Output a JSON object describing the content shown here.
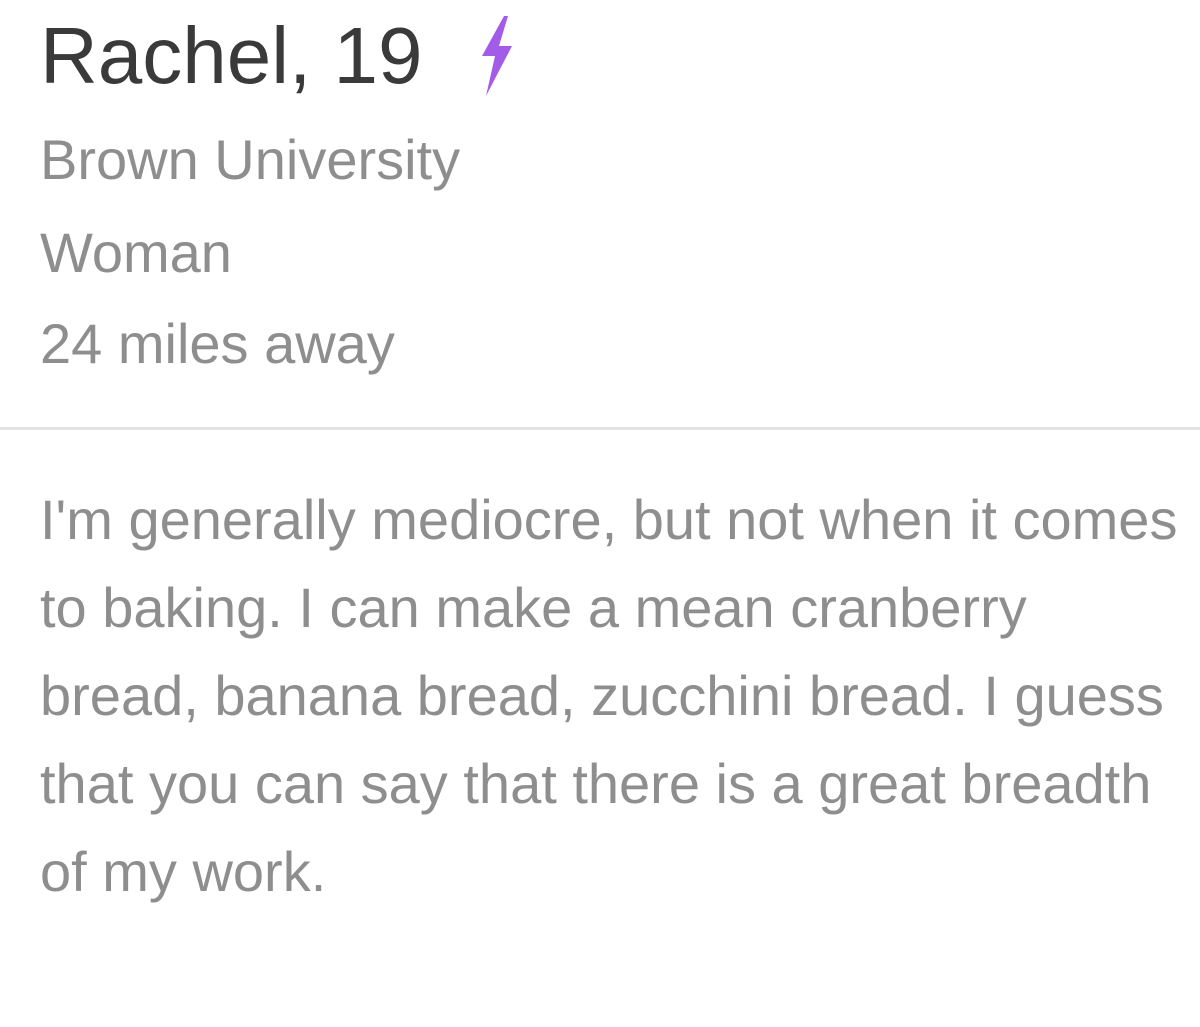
{
  "profile": {
    "name_age": "Rachel, 19",
    "boost_icon": "lightning-bolt-icon",
    "school": "Brown University",
    "gender": "Woman",
    "distance": "24 miles away",
    "bio": "I'm generally mediocre, but not when it comes to baking. I can make a mean cranberry bread, banana bread, zucchini bread. I guess that you can say that there is a great breadth of my work."
  },
  "colors": {
    "name": "#3a3a3a",
    "secondary_text": "#8e8e8e",
    "boost_purple": "#a35ce8",
    "divider": "#e3e3e3"
  }
}
